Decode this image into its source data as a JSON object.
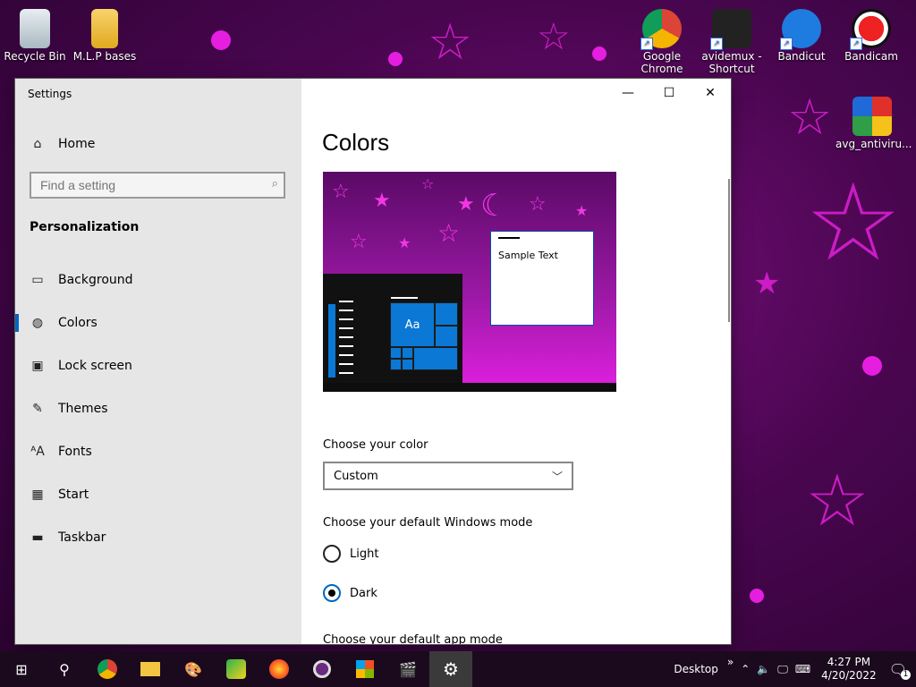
{
  "desktop": {
    "icons": [
      {
        "label": "Recycle Bin"
      },
      {
        "label": "M.L.P bases"
      },
      {
        "label": "Google Chrome"
      },
      {
        "label": "avidemux - Shortcut"
      },
      {
        "label": "Bandicut"
      },
      {
        "label": "Bandicam"
      },
      {
        "label": "avg_antiviru..."
      }
    ]
  },
  "window": {
    "title": "Settings",
    "controls": {
      "minimize": "—",
      "maximize": "☐",
      "close": "✕"
    }
  },
  "nav": {
    "home": "Home",
    "search_placeholder": "Find a setting",
    "section": "Personalization",
    "items": [
      {
        "label": "Background"
      },
      {
        "label": "Colors"
      },
      {
        "label": "Lock screen"
      },
      {
        "label": "Themes"
      },
      {
        "label": "Fonts"
      },
      {
        "label": "Start"
      },
      {
        "label": "Taskbar"
      }
    ]
  },
  "content": {
    "title": "Colors",
    "preview": {
      "sample_text": "Sample Text",
      "tile_label": "Aa"
    },
    "choose_color_label": "Choose your color",
    "color_value": "Custom",
    "windows_mode_label": "Choose your default Windows mode",
    "windows_mode_options": [
      "Light",
      "Dark"
    ],
    "windows_mode_selected": "Dark",
    "app_mode_label": "Choose your default app mode"
  },
  "taskbar": {
    "desktop_label": "Desktop",
    "overflow": "»",
    "time": "4:27 PM",
    "date": "4/20/2022",
    "notifications_count": "1"
  },
  "colors": {
    "accent": "#0067c0",
    "tile": "#0a78d4",
    "desktop_pink": "#e020d8"
  }
}
